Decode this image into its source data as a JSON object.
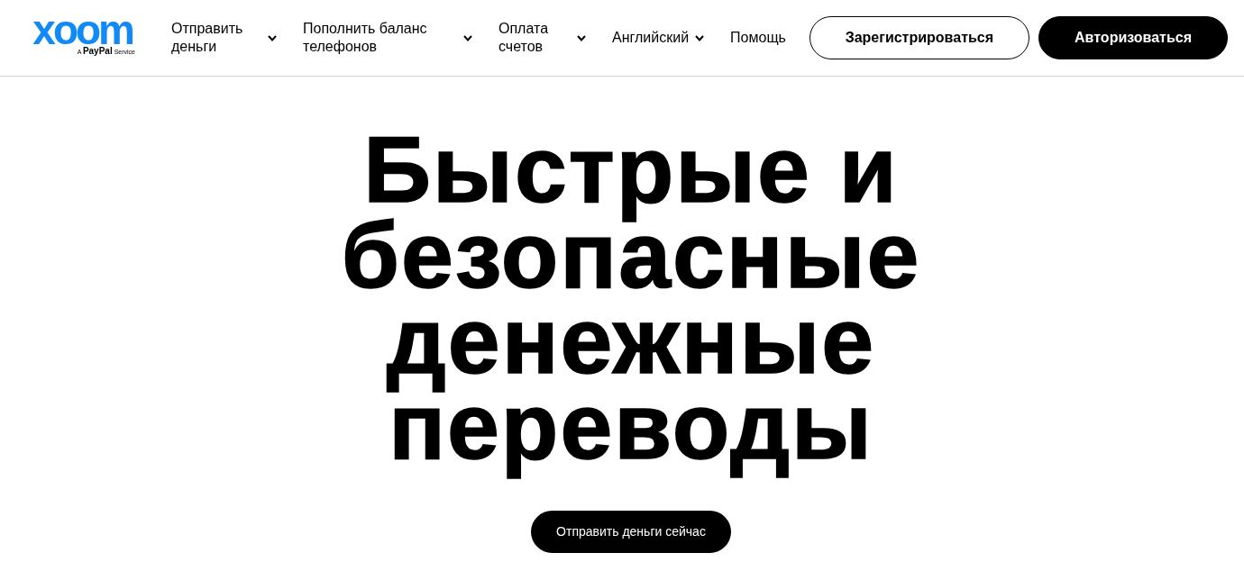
{
  "header": {
    "logo": {
      "wordmark": "xoom",
      "tagline": "A **PayPal** Service"
    },
    "nav": [
      {
        "label": "Отправить деньги",
        "kind": "dropdown"
      },
      {
        "label": "Пополнить баланс телефонов",
        "kind": "dropdown"
      },
      {
        "label": "Оплата счетов",
        "kind": "dropdown"
      },
      {
        "label": "Английский",
        "kind": "dropdown"
      },
      {
        "label": "Помощь",
        "kind": "link"
      }
    ],
    "buttons": [
      {
        "label": "Зарегистрироваться",
        "kind": "outline"
      },
      {
        "label": "Авторизоваться",
        "kind": "filled"
      }
    ]
  },
  "hero": {
    "heading": "Быстрые и безопасные денежные переводы",
    "cta": "Отправить деньги сейчас"
  }
}
